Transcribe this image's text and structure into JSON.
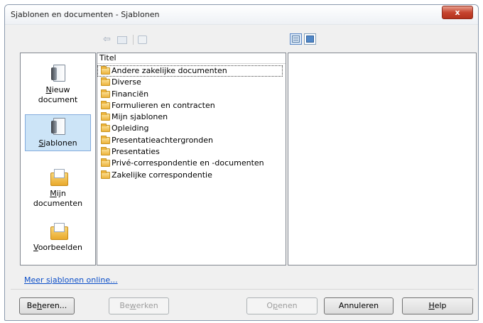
{
  "window": {
    "title": "Sjablonen en documenten - Sjablonen",
    "close_label": "x"
  },
  "toolbar": {
    "back_icon": "back-arrow-icon",
    "up_icon": "folder-up-icon",
    "print_icon": "print-icon",
    "view_buttons": [
      "detail-view-icon",
      "preview-view-icon"
    ]
  },
  "categories": [
    {
      "pre": "",
      "mnemonic": "N",
      "post": "ieuw",
      "line2": "document",
      "icon": "new-document-icon",
      "selected": false
    },
    {
      "pre": "",
      "mnemonic": "S",
      "post": "jablonen",
      "line2": "",
      "icon": "templates-icon",
      "selected": true
    },
    {
      "pre": "",
      "mnemonic": "M",
      "post": "ijn",
      "line2": "documenten",
      "icon": "my-documents-icon",
      "selected": false
    },
    {
      "pre": "",
      "mnemonic": "V",
      "post": "oorbeelden",
      "line2": "",
      "icon": "examples-icon",
      "selected": false
    }
  ],
  "list": {
    "column_header": "Titel",
    "items": [
      "Andere zakelijke documenten",
      "Diverse",
      "Financiën",
      "Formulieren en contracten",
      "Mijn sjablonen",
      "Opleiding",
      "Presentatieachtergronden",
      "Presentaties",
      "Privé-correspondentie en -documenten",
      "Zakelijke correspondentie"
    ]
  },
  "more_link": {
    "pre": "Meer ",
    "mnemonic": "s",
    "post": "jablonen online..."
  },
  "buttons": {
    "manage": {
      "pre": "Be",
      "mnemonic": "h",
      "post": "eren..."
    },
    "edit": {
      "pre": "Be",
      "mnemonic": "w",
      "post": "erken"
    },
    "open": {
      "pre": "O",
      "mnemonic": "p",
      "post": "enen"
    },
    "cancel": {
      "label": "Annuleren"
    },
    "help": {
      "pre": "",
      "mnemonic": "H",
      "post": "elp"
    }
  }
}
